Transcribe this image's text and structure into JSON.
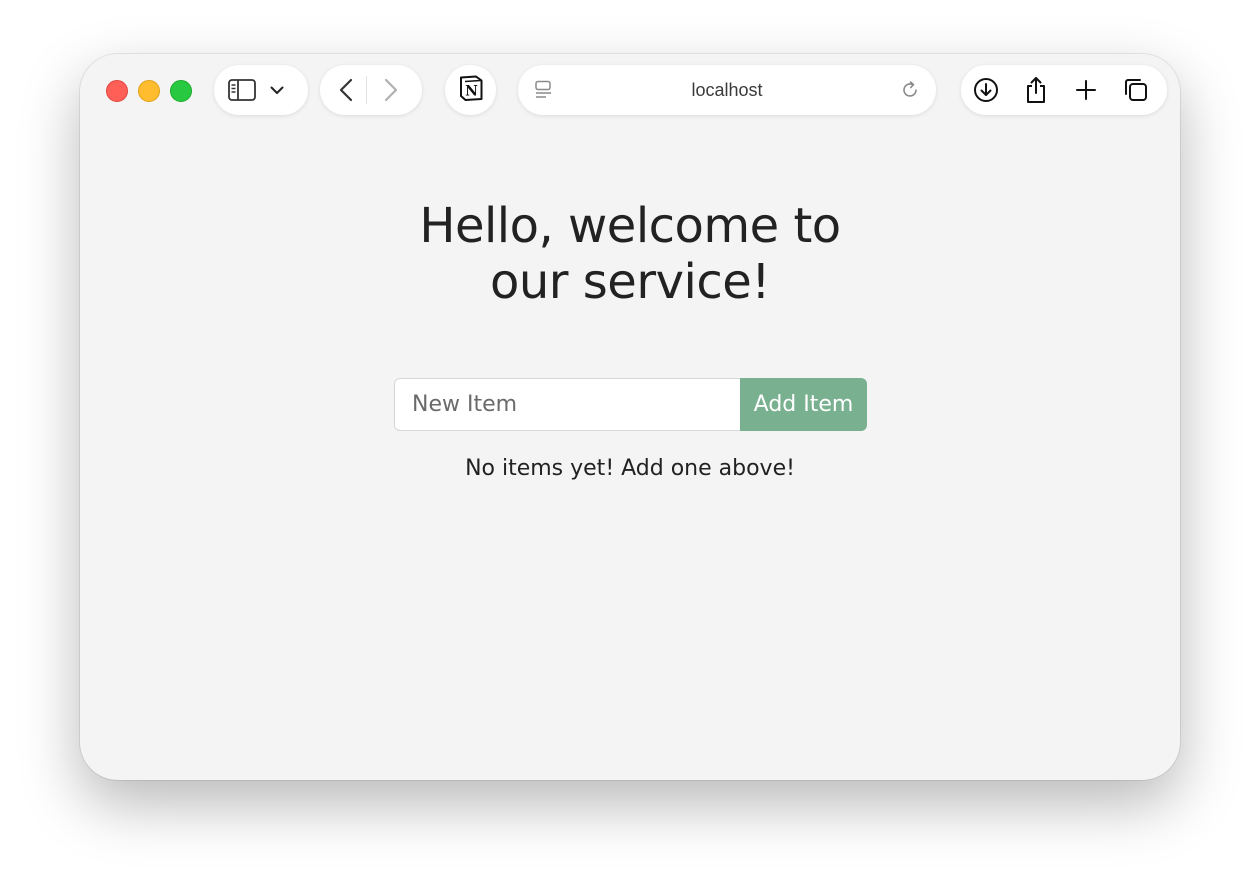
{
  "browser": {
    "address": "localhost",
    "icons": {
      "sidebar": "sidebar-icon",
      "chevron": "chevron-down-icon",
      "back": "back-icon",
      "forward": "forward-icon",
      "notion": "notion-icon",
      "page_menu": "page-menu-icon",
      "reload": "reload-icon",
      "download": "download-icon",
      "share": "share-icon",
      "new_tab": "plus-icon",
      "tabs": "tab-overview-icon"
    },
    "colors": {
      "close": "#ff5f57",
      "minimize": "#febc2e",
      "maximize": "#28c840"
    }
  },
  "page": {
    "heading": "Hello, welcome to our service!",
    "input_placeholder": "New Item",
    "add_button_label": "Add Item",
    "empty_message": "No items yet! Add one above!",
    "accent_color": "#79b08f"
  }
}
